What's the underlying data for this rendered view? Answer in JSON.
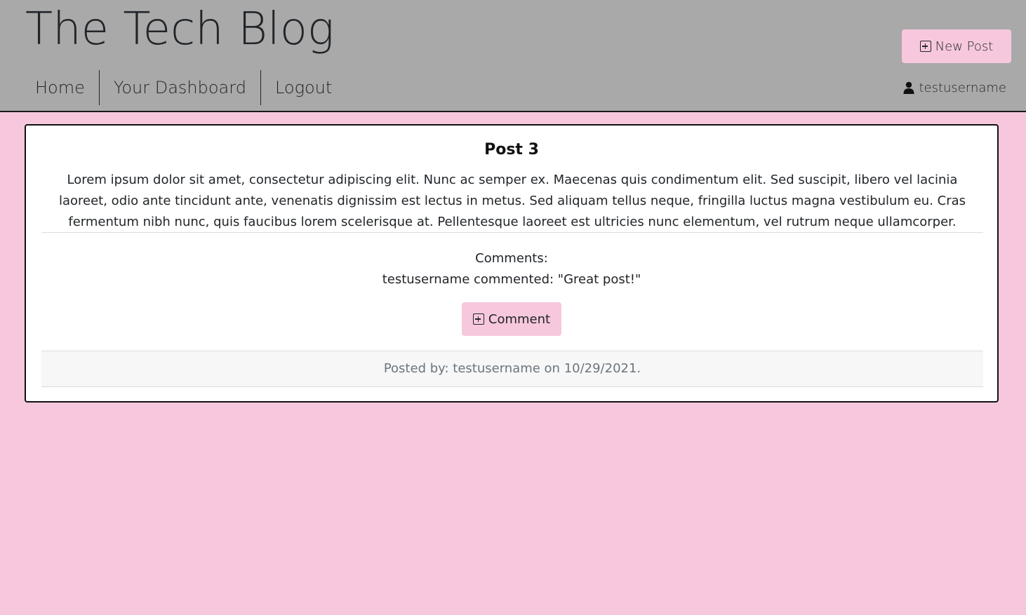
{
  "header": {
    "site_title": "The Tech Blog",
    "nav": [
      {
        "label": "Home"
      },
      {
        "label": "Your Dashboard"
      },
      {
        "label": "Logout"
      }
    ],
    "new_post_label": "New Post",
    "username": "testusername"
  },
  "post": {
    "title": "Post 3",
    "body": "Lorem ipsum dolor sit amet, consectetur adipiscing elit. Nunc ac semper ex. Maecenas quis condimentum elit. Sed suscipit, libero vel lacinia laoreet, odio ante tincidunt ante, venenatis dignissim est lectus in metus. Sed aliquam tellus neque, fringilla luctus magna vestibulum eu. Cras fermentum nibh nunc, quis faucibus lorem scelerisque at. Pellentesque laoreet est ultricies nunc elementum, vel rutrum neque ullamcorper.",
    "comments_label": "Comments:",
    "comments": [
      {
        "text": "testusername commented: \"Great post!\""
      }
    ],
    "comment_button_label": "Comment",
    "footer": "Posted by: testusername on 10/29/2021."
  },
  "colors": {
    "page_background": "#f7c8dd",
    "header_background": "#a9a9a9",
    "button_background": "#f7c8dd"
  }
}
